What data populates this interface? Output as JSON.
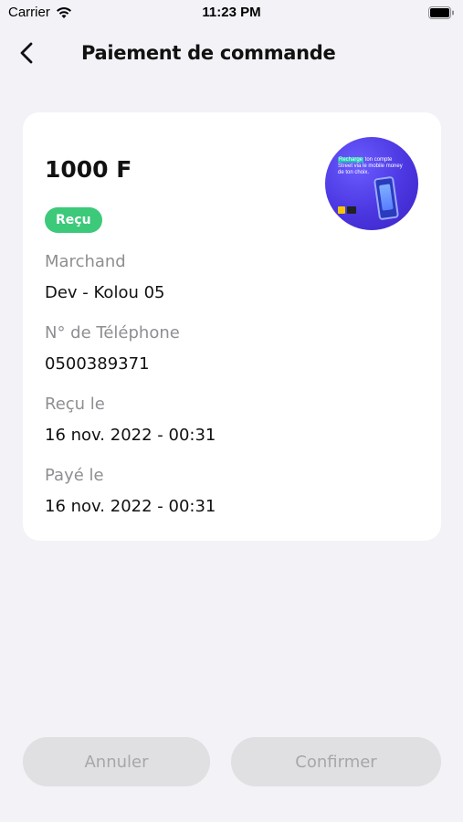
{
  "status_bar": {
    "carrier": "Carrier",
    "time": "11:23 PM"
  },
  "nav": {
    "title": "Paiement de commande",
    "back_icon": "chevron-left-icon"
  },
  "card": {
    "amount": "1000 F",
    "status_badge": "Reçu",
    "status_color": "#3cc97a",
    "promo": {
      "highlight": "Recharge",
      "text": " ton compte Street via le mobile money de ton choix."
    },
    "fields": [
      {
        "label": "Marchand",
        "value": "Dev - Kolou 05"
      },
      {
        "label": "N° de Téléphone",
        "value": "0500389371"
      },
      {
        "label": "Reçu le",
        "value": "16 nov. 2022 - 00:31"
      },
      {
        "label": "Payé le",
        "value": "16 nov. 2022 - 00:31"
      }
    ]
  },
  "actions": {
    "cancel_label": "Annuler",
    "confirm_label": "Confirmer"
  }
}
